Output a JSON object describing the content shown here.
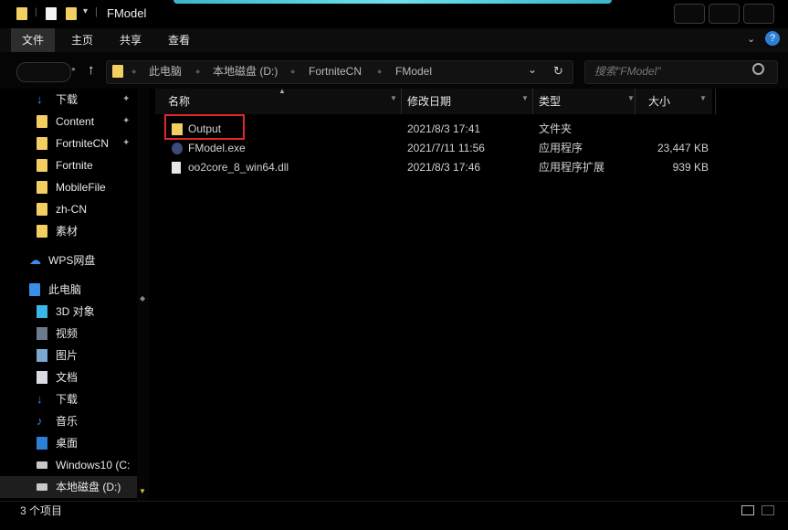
{
  "window": {
    "title": "FModel"
  },
  "ribbon": {
    "tabs": [
      "文件",
      "主页",
      "共享",
      "查看"
    ]
  },
  "address": {
    "crumbs": [
      "此电脑",
      "本地磁盘 (D:)",
      "FortniteCN",
      "FModel"
    ],
    "search_placeholder": "搜索\"FModel\""
  },
  "nav": {
    "quick": [
      {
        "label": "下载",
        "icon": "download-arrow-icon",
        "pinned": true
      },
      {
        "label": "Content",
        "icon": "folder-icon",
        "pinned": true
      },
      {
        "label": "FortniteCN",
        "icon": "folder-icon",
        "pinned": true
      },
      {
        "label": "Fortnite",
        "icon": "folder-icon",
        "pinned": false
      },
      {
        "label": "MobileFile",
        "icon": "folder-icon",
        "pinned": false
      },
      {
        "label": "zh-CN",
        "icon": "folder-icon",
        "pinned": false
      },
      {
        "label": "素材",
        "icon": "folder-icon",
        "pinned": false
      }
    ],
    "cloud": {
      "label": "WPS网盘",
      "icon": "cloud-icon"
    },
    "pc": {
      "label": "此电脑",
      "icon": "computer-icon"
    },
    "pc_items": [
      {
        "label": "3D 对象",
        "icon": "cube-icon"
      },
      {
        "label": "视频",
        "icon": "video-icon"
      },
      {
        "label": "图片",
        "icon": "picture-icon"
      },
      {
        "label": "文档",
        "icon": "document-icon"
      },
      {
        "label": "下载",
        "icon": "download-arrow-icon"
      },
      {
        "label": "音乐",
        "icon": "music-note-icon"
      },
      {
        "label": "桌面",
        "icon": "desktop-icon"
      },
      {
        "label": "Windows10 (C:",
        "icon": "drive-icon"
      },
      {
        "label": "本地磁盘 (D:)",
        "icon": "drive-icon"
      }
    ]
  },
  "columns": {
    "name": "名称",
    "date": "修改日期",
    "type": "类型",
    "size": "大小"
  },
  "files": [
    {
      "name": "Output",
      "date": "2021/8/3 17:41",
      "type": "文件夹",
      "size": "",
      "icon": "folder-icon"
    },
    {
      "name": "FModel.exe",
      "date": "2021/7/11 11:56",
      "type": "应用程序",
      "size": "23,447 KB",
      "icon": "app-icon"
    },
    {
      "name": "oo2core_8_win64.dll",
      "date": "2021/8/3 17:46",
      "type": "应用程序扩展",
      "size": "939 KB",
      "icon": "dll-file-icon"
    }
  ],
  "status": {
    "count": "3 个项目"
  },
  "colors": {
    "folder": "#f3cf62",
    "highlight": "#e02828",
    "accent": "#3ab6c8"
  }
}
